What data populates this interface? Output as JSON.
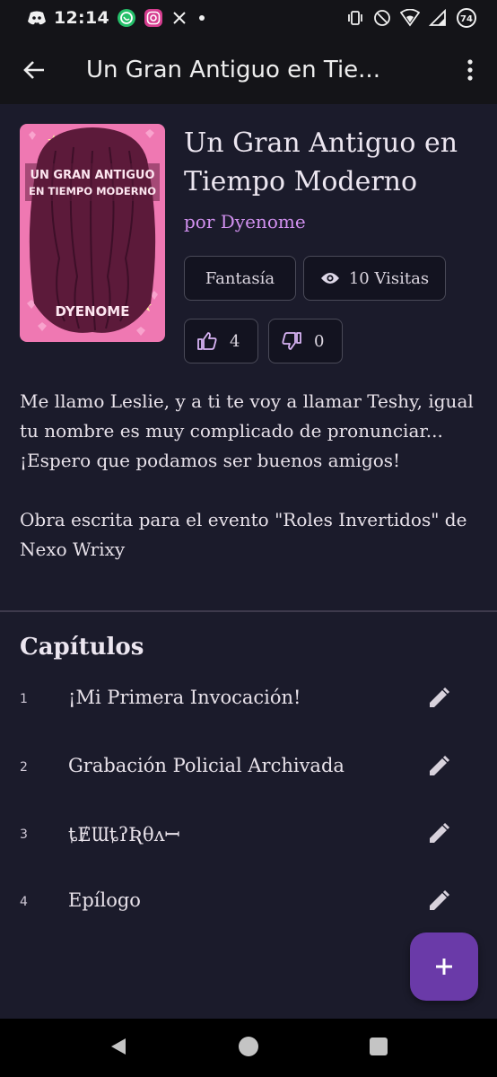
{
  "status_bar": {
    "time": "12:14",
    "left_icons": [
      "discord-icon",
      "whatsapp-icon",
      "instagram-icon",
      "x-icon",
      "dot-icon"
    ],
    "right_icons": [
      "vibrate-icon",
      "do-not-disturb-icon",
      "wifi-icon",
      "signal-icon",
      "battery-icon"
    ],
    "battery_level": "74"
  },
  "app_bar": {
    "title": "Un Gran Antiguo en Tie...",
    "back_icon": "arrow-back-icon",
    "menu_icon": "more-vert-icon"
  },
  "book": {
    "title": "Un Gran Antiguo en Tiempo Moderno",
    "author": "por Dyenome",
    "cover": {
      "title_line1": "UN GRAN ANTIGUO",
      "title_line2": "EN TIEMPO MODERNO",
      "author": "DYENOME"
    },
    "genre": "Fantasía",
    "views": "10 Visitas",
    "likes": "4",
    "dislikes": "0",
    "description": "Me llamo Leslie, y a ti te voy a llamar Teshy, igual tu nombre es muy complicado de pronunciar... ¡Espero que podamos ser buenos amigos!\n\nObra escrita para el evento \"Roles Invertidos\" de Nexo Wrixy"
  },
  "chapters": {
    "heading": "Capítulos",
    "items": [
      {
        "number": "1",
        "title": "¡Mi Primera Invocación!"
      },
      {
        "number": "2",
        "title": "Grabación Policial Archivada"
      },
      {
        "number": "3",
        "title": "ȶɆƜȶʔƦθʌꟷ"
      },
      {
        "number": "4",
        "title": "Epílogo"
      }
    ]
  },
  "fab": {
    "icon": "add-icon"
  },
  "nav_bar": {
    "icons": [
      "back-triangle-icon",
      "home-circle-icon",
      "recents-square-icon"
    ]
  },
  "colors": {
    "background": "#1b1b2b",
    "bar": "#141418",
    "accent": "#d291f0",
    "fab": "#6a3aa8",
    "cover_pink": "#ef78b2",
    "cover_hair": "#5c1a3a"
  }
}
